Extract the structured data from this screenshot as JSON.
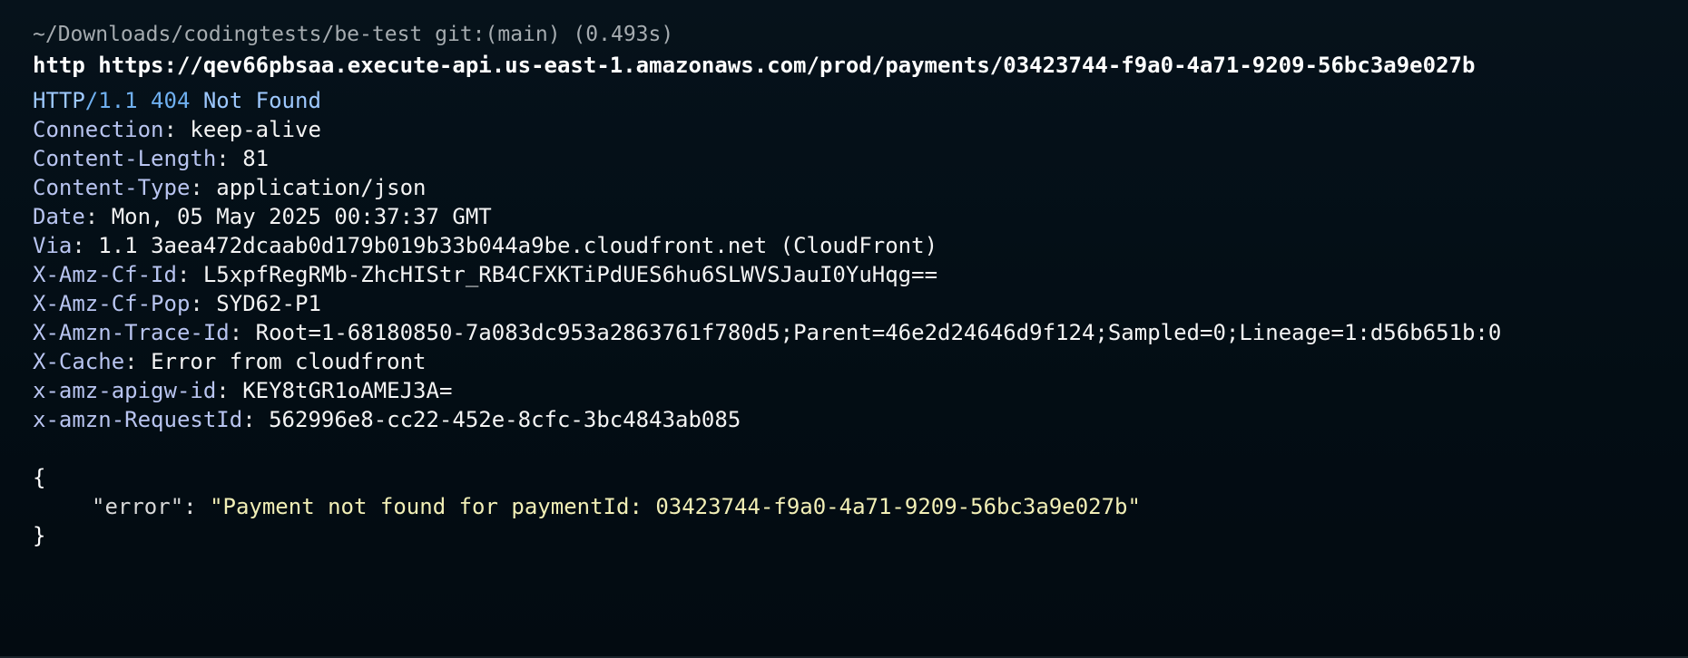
{
  "prompt": {
    "path_line": "~/Downloads/codingtests/be-test git:(main) (0.493s)"
  },
  "command": {
    "text": "http https://qev66pbsaa.execute-api.us-east-1.amazonaws.com/prod/payments/03423744-f9a0-4a71-9209-56bc3a9e027b"
  },
  "response": {
    "status": {
      "protocol": "HTTP",
      "version": "/1.1",
      "code": "404",
      "reason": "Not Found"
    },
    "headers": [
      {
        "name": "Connection",
        "value": "keep-alive"
      },
      {
        "name": "Content-Length",
        "value": "81"
      },
      {
        "name": "Content-Type",
        "value": "application/json"
      },
      {
        "name": "Date",
        "value": "Mon, 05 May 2025 00:37:37 GMT"
      },
      {
        "name": "Via",
        "value": "1.1 3aea472dcaab0d179b019b33b044a9be.cloudfront.net (CloudFront)"
      },
      {
        "name": "X-Amz-Cf-Id",
        "value": "L5xpfRegRMb-ZhcHIStr_RB4CFXKTiPdUES6hu6SLWVSJauI0YuHqg=="
      },
      {
        "name": "X-Amz-Cf-Pop",
        "value": "SYD62-P1"
      },
      {
        "name": "X-Amzn-Trace-Id",
        "value": "Root=1-68180850-7a083dc953a2863761f780d5;Parent=46e2d24646d9f124;Sampled=0;Lineage=1:d56b651b:0"
      },
      {
        "name": "X-Cache",
        "value": "Error from cloudfront"
      },
      {
        "name": "x-amz-apigw-id",
        "value": "KEY8tGR1oAMEJ3A="
      },
      {
        "name": "x-amzn-RequestId",
        "value": "562996e8-cc22-452e-8cfc-3bc4843ab085"
      }
    ],
    "body": {
      "open_brace": "{",
      "key": "\"error\"",
      "value": "\"Payment not found for paymentId: 03423744-f9a0-4a71-9209-56bc3a9e027b\"",
      "close_brace": "}"
    }
  }
}
